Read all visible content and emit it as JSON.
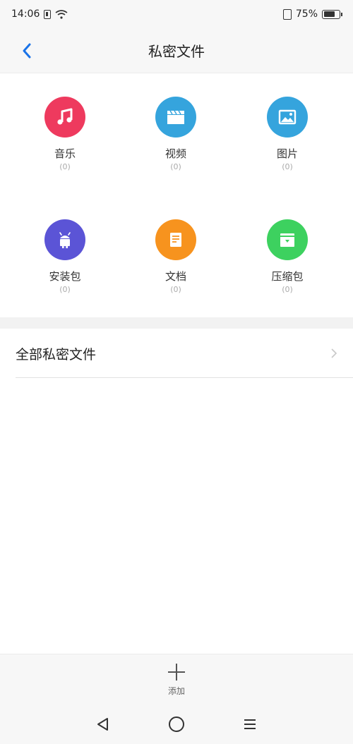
{
  "status_bar": {
    "time": "14:06",
    "battery_percent": "75%",
    "battery_level": 0.75
  },
  "header": {
    "title": "私密文件",
    "back_icon": "chevron-left-icon"
  },
  "categories": [
    {
      "label": "音乐",
      "count": "(0)",
      "icon": "music-note-icon",
      "color": "#ee3a5e"
    },
    {
      "label": "视频",
      "count": "(0)",
      "icon": "film-clapper-icon",
      "color": "#35a4dd"
    },
    {
      "label": "图片",
      "count": "(0)",
      "icon": "image-icon",
      "color": "#35a4dd"
    },
    {
      "label": "安装包",
      "count": "(0)",
      "icon": "android-icon",
      "color": "#5b54d6"
    },
    {
      "label": "文档",
      "count": "(0)",
      "icon": "document-icon",
      "color": "#f7931e"
    },
    {
      "label": "压缩包",
      "count": "(0)",
      "icon": "archive-icon",
      "color": "#3dd15f"
    }
  ],
  "all_files": {
    "label": "全部私密文件",
    "icon": "chevron-right-icon"
  },
  "bottom": {
    "add_label": "添加",
    "add_icon": "plus-icon"
  },
  "nav": {
    "back_icon": "triangle-back-icon",
    "home_icon": "circle-home-icon",
    "menu_icon": "menu-icon"
  },
  "colors": {
    "accent": "#1a73e8",
    "background": "#f7f7f7"
  }
}
